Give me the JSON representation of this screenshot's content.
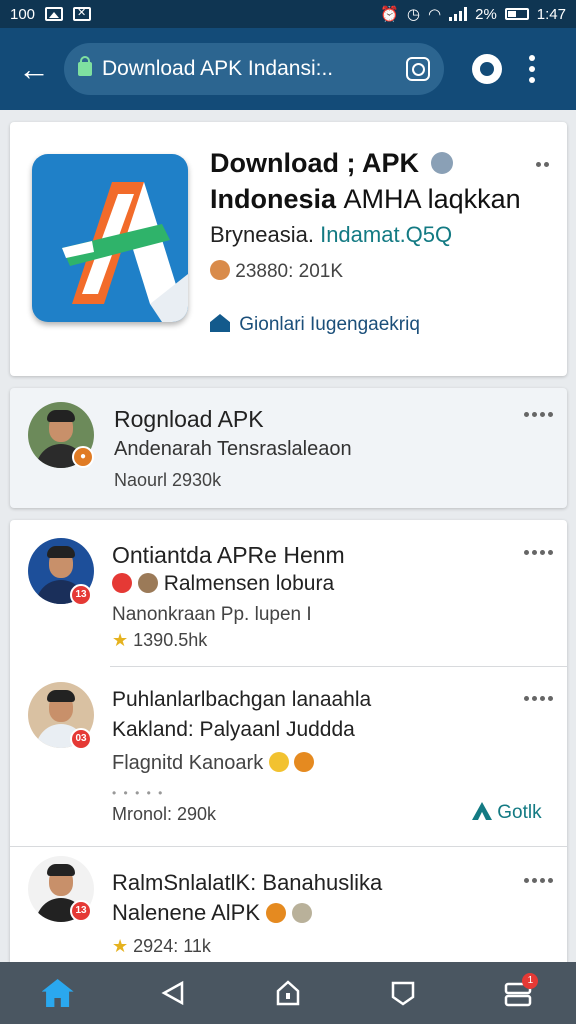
{
  "status_bar": {
    "left_text": "100",
    "battery": "2%",
    "time": "1:47"
  },
  "app_bar": {
    "url_text": "Download APK  Indansi:..",
    "icons": [
      "back-arrow-icon",
      "lock-icon",
      "instagram-icon",
      "chat-icon",
      "more-vertical-icon"
    ]
  },
  "app_card": {
    "title_line1": "Download ; APK",
    "title_line2": "Indonesia",
    "title_line2_suffix": "AMHA laqkkan",
    "subtitle_plain": "Bryneasia.",
    "subtitle_accent": "Indamat.Q5Q",
    "stats": "23880: 201K",
    "action": "Gionlari Iugengaekriq",
    "colors": {
      "logo_bg": "#1f80c8",
      "accent": "#137a83"
    }
  },
  "post_1": {
    "title": "Rognload APK",
    "line1": "Andenarah Tensraslaleaon",
    "meta": "Naourl 2930k"
  },
  "post_2": {
    "title": "Ontiantda APRe Henm",
    "line1": "Ralmensen lobura",
    "line2": "Nanonkraan Pp. lupen I",
    "meta": "1390.5hk",
    "badge": "13"
  },
  "post_3": {
    "title_line1": "Puhlanlarlbachgan lanaahla",
    "title_line2": "Kakland: Palyaanl Juddda",
    "line1": "Flagnitd Kanoark",
    "meta": "Mronol: 290k",
    "action": "Gotlk",
    "badge": "03"
  },
  "post_4": {
    "title_line1": "RalmSnlalatlK: Banahuslika",
    "title_line2": "Nalenene AlPK",
    "meta": "2924: 11k",
    "badge": "13"
  },
  "nav_bar": {
    "items": [
      "home-icon",
      "back-triangle-icon",
      "home-circle-icon",
      "recents-icon",
      "tabs-icon"
    ],
    "tabs_badge": "1"
  }
}
